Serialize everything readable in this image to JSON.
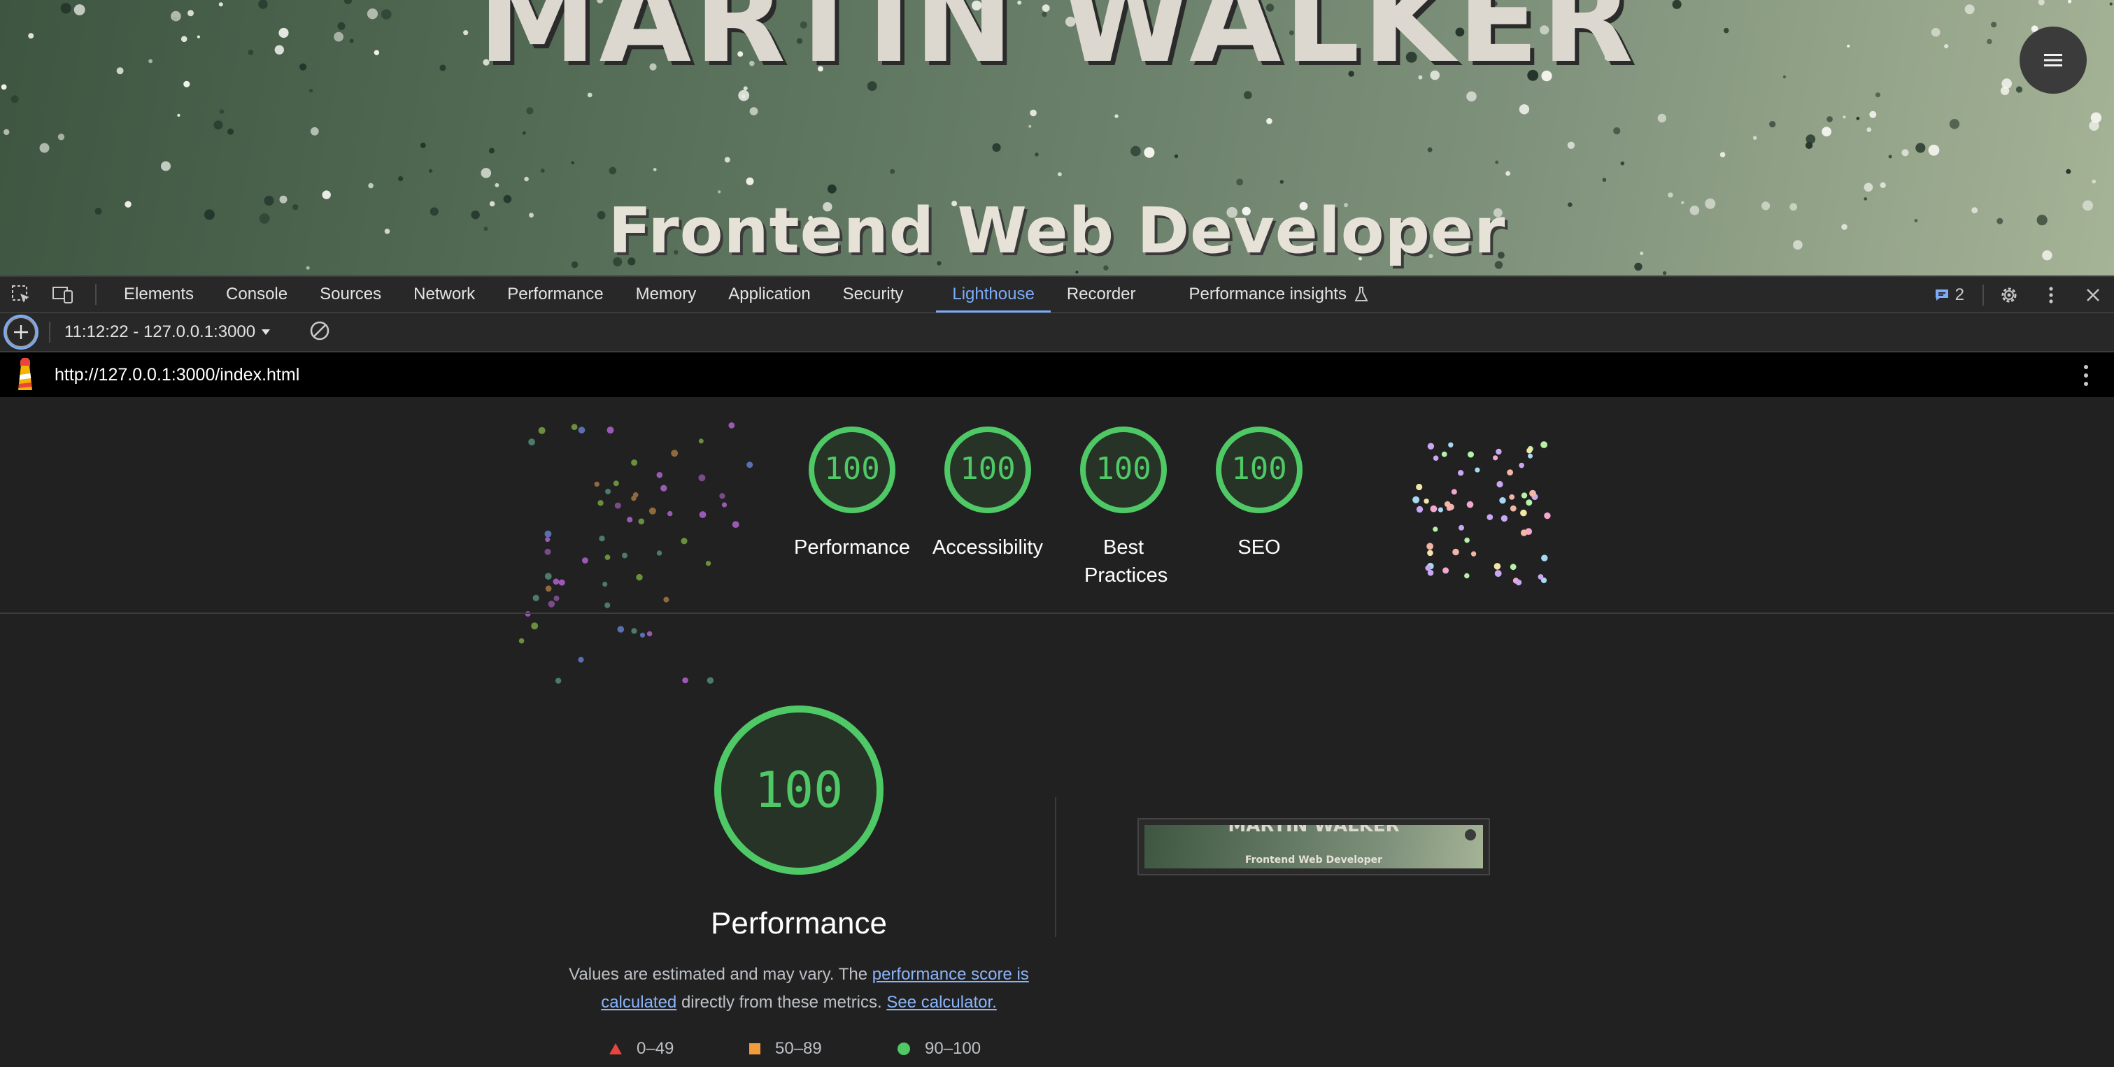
{
  "hero": {
    "name": "MARTIN WALKER",
    "role": "Frontend Web Developer",
    "menu_icon": "hamburger-menu-icon"
  },
  "devtools": {
    "tabs": [
      "Elements",
      "Console",
      "Sources",
      "Network",
      "Performance",
      "Memory",
      "Application",
      "Security",
      "Lighthouse",
      "Recorder",
      "Performance insights"
    ],
    "active_tab": "Lighthouse",
    "issues_count": "2",
    "accent_color": "#7cacf8"
  },
  "lighthouse": {
    "report_select": "11:12:22 - 127.0.0.1:3000",
    "url": "http://127.0.0.1:3000/index.html",
    "categories": [
      {
        "label": "Performance",
        "score": 100
      },
      {
        "label": "Accessibility",
        "score": 100
      },
      {
        "label": "Best Practices",
        "score": 100
      },
      {
        "label": "SEO",
        "score": 100
      }
    ],
    "pass_color": "#4fc866",
    "main": {
      "score": 100,
      "title": "Performance",
      "desc_pre": "Values are estimated and may vary. The ",
      "desc_link1": "performance score is calculated",
      "desc_mid": " directly from these metrics. ",
      "desc_link2": "See calculator."
    },
    "legend": [
      {
        "range": "0–49",
        "color": "#e8453c"
      },
      {
        "range": "50–89",
        "color": "#f29b3c"
      },
      {
        "range": "90–100",
        "color": "#4fc866"
      }
    ],
    "thumbnail": {
      "name": "MARTIN WALKER",
      "role": "Frontend Web Developer"
    }
  }
}
